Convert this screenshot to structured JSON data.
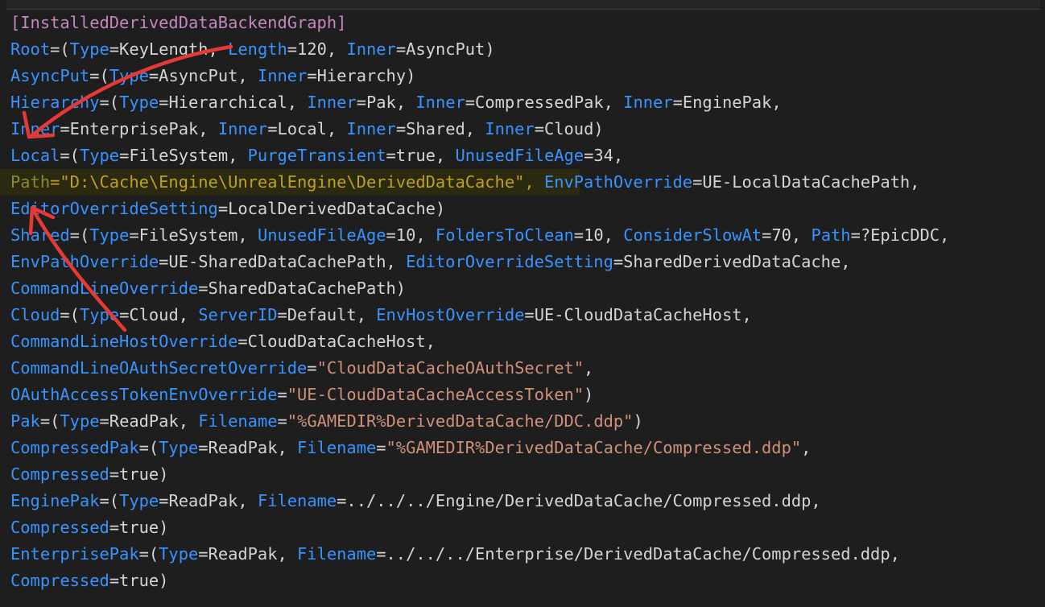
{
  "title": "[InstalledDerivedDataBackendGraph]",
  "lines": [
    [
      {
        "t": "[InstalledDerivedDataBackendGraph]",
        "c": "sec"
      }
    ],
    [
      {
        "t": "Root",
        "c": "k"
      },
      {
        "t": "=(",
        "c": "v"
      },
      {
        "t": "Type",
        "c": "k"
      },
      {
        "t": "=KeyLength, ",
        "c": "v"
      },
      {
        "t": "Length",
        "c": "k"
      },
      {
        "t": "=120, ",
        "c": "v"
      },
      {
        "t": "Inner",
        "c": "k"
      },
      {
        "t": "=AsyncPut)",
        "c": "v"
      }
    ],
    [
      {
        "t": "AsyncPut",
        "c": "k"
      },
      {
        "t": "=(",
        "c": "v"
      },
      {
        "t": "Type",
        "c": "k"
      },
      {
        "t": "=AsyncPut, ",
        "c": "v"
      },
      {
        "t": "Inner",
        "c": "k"
      },
      {
        "t": "=Hierarchy)",
        "c": "v"
      }
    ],
    [
      {
        "t": "Hierarchy",
        "c": "k"
      },
      {
        "t": "=(",
        "c": "v"
      },
      {
        "t": "Type",
        "c": "k"
      },
      {
        "t": "=Hierarchical, ",
        "c": "v"
      },
      {
        "t": "Inner",
        "c": "k"
      },
      {
        "t": "=Pak, ",
        "c": "v"
      },
      {
        "t": "Inner",
        "c": "k"
      },
      {
        "t": "=CompressedPak, ",
        "c": "v"
      },
      {
        "t": "Inner",
        "c": "k"
      },
      {
        "t": "=EnginePak,",
        "c": "v"
      }
    ],
    [
      {
        "t": "Inner",
        "c": "k"
      },
      {
        "t": "=EnterprisePak, ",
        "c": "v"
      },
      {
        "t": "Inner",
        "c": "k"
      },
      {
        "t": "=Local, ",
        "c": "v"
      },
      {
        "t": "Inner",
        "c": "k"
      },
      {
        "t": "=Shared, ",
        "c": "v"
      },
      {
        "t": "Inner",
        "c": "k"
      },
      {
        "t": "=Cloud)",
        "c": "v"
      }
    ],
    [
      {
        "t": "Local",
        "c": "k"
      },
      {
        "t": "=(",
        "c": "v"
      },
      {
        "t": "Type",
        "c": "k"
      },
      {
        "t": "=FileSystem, ",
        "c": "v"
      },
      {
        "t": "PurgeTransient",
        "c": "k"
      },
      {
        "t": "=true, ",
        "c": "v"
      },
      {
        "t": "UnusedFileAge",
        "c": "k"
      },
      {
        "t": "=34,",
        "c": "v"
      }
    ],
    [
      {
        "t": "Path",
        "c": "hk"
      },
      {
        "t": "=",
        "c": "hs"
      },
      {
        "t": "\"D:\\Cache\\Engine\\UnrealEngine\\DerivedDataCache\",",
        "c": "hs"
      },
      {
        "t": " ",
        "c": "v"
      },
      {
        "t": "EnvPathOverride",
        "c": "k"
      },
      {
        "t": "=UE-LocalDataCachePath,",
        "c": "v"
      }
    ],
    [
      {
        "t": "EditorOverrideSetting",
        "c": "k"
      },
      {
        "t": "=LocalDerivedDataCache)",
        "c": "v"
      }
    ],
    [
      {
        "t": "Shared",
        "c": "k"
      },
      {
        "t": "=(",
        "c": "v"
      },
      {
        "t": "Type",
        "c": "k"
      },
      {
        "t": "=FileSystem, ",
        "c": "v"
      },
      {
        "t": "UnusedFileAge",
        "c": "k"
      },
      {
        "t": "=10, ",
        "c": "v"
      },
      {
        "t": "FoldersToClean",
        "c": "k"
      },
      {
        "t": "=10, ",
        "c": "v"
      },
      {
        "t": "ConsiderSlowAt",
        "c": "k"
      },
      {
        "t": "=70, ",
        "c": "v"
      },
      {
        "t": "Path",
        "c": "k"
      },
      {
        "t": "=?EpicDDC,",
        "c": "v"
      }
    ],
    [
      {
        "t": "EnvPathOverride",
        "c": "k"
      },
      {
        "t": "=UE-SharedDataCachePath, ",
        "c": "v"
      },
      {
        "t": "EditorOverrideSetting",
        "c": "k"
      },
      {
        "t": "=SharedDerivedDataCache,",
        "c": "v"
      }
    ],
    [
      {
        "t": "CommandLineOverride",
        "c": "k"
      },
      {
        "t": "=SharedDataCachePath)",
        "c": "v"
      }
    ],
    [
      {
        "t": "Cloud",
        "c": "k"
      },
      {
        "t": "=(",
        "c": "v"
      },
      {
        "t": "Type",
        "c": "k"
      },
      {
        "t": "=Cloud, ",
        "c": "v"
      },
      {
        "t": "ServerID",
        "c": "k"
      },
      {
        "t": "=Default, ",
        "c": "v"
      },
      {
        "t": "EnvHostOverride",
        "c": "k"
      },
      {
        "t": "=UE-CloudDataCacheHost,",
        "c": "v"
      }
    ],
    [
      {
        "t": "CommandLineHostOverride",
        "c": "k"
      },
      {
        "t": "=CloudDataCacheHost,",
        "c": "v"
      }
    ],
    [
      {
        "t": "CommandLineOAuthSecretOverride",
        "c": "k"
      },
      {
        "t": "=",
        "c": "v"
      },
      {
        "t": "\"CloudDataCacheOAuthSecret\"",
        "c": "s"
      },
      {
        "t": ",",
        "c": "v"
      }
    ],
    [
      {
        "t": "OAuthAccessTokenEnvOverride",
        "c": "k"
      },
      {
        "t": "=",
        "c": "v"
      },
      {
        "t": "\"UE-CloudDataCacheAccessToken\"",
        "c": "s"
      },
      {
        "t": ")",
        "c": "v"
      }
    ],
    [
      {
        "t": "Pak",
        "c": "k"
      },
      {
        "t": "=(",
        "c": "v"
      },
      {
        "t": "Type",
        "c": "k"
      },
      {
        "t": "=ReadPak, ",
        "c": "v"
      },
      {
        "t": "Filename",
        "c": "k"
      },
      {
        "t": "=",
        "c": "v"
      },
      {
        "t": "\"%GAMEDIR%DerivedDataCache/DDC.ddp\"",
        "c": "s"
      },
      {
        "t": ")",
        "c": "v"
      }
    ],
    [
      {
        "t": "CompressedPak",
        "c": "k"
      },
      {
        "t": "=(",
        "c": "v"
      },
      {
        "t": "Type",
        "c": "k"
      },
      {
        "t": "=ReadPak, ",
        "c": "v"
      },
      {
        "t": "Filename",
        "c": "k"
      },
      {
        "t": "=",
        "c": "v"
      },
      {
        "t": "\"%GAMEDIR%DerivedDataCache/Compressed.ddp\"",
        "c": "s"
      },
      {
        "t": ",",
        "c": "v"
      }
    ],
    [
      {
        "t": "Compressed",
        "c": "k"
      },
      {
        "t": "=true)",
        "c": "v"
      }
    ],
    [
      {
        "t": "EnginePak",
        "c": "k"
      },
      {
        "t": "=(",
        "c": "v"
      },
      {
        "t": "Type",
        "c": "k"
      },
      {
        "t": "=ReadPak, ",
        "c": "v"
      },
      {
        "t": "Filename",
        "c": "k"
      },
      {
        "t": "=../../../Engine/DerivedDataCache/Compressed.ddp,",
        "c": "v"
      }
    ],
    [
      {
        "t": "Compressed",
        "c": "k"
      },
      {
        "t": "=true)",
        "c": "v"
      }
    ],
    [
      {
        "t": "EnterprisePak",
        "c": "k"
      },
      {
        "t": "=(",
        "c": "v"
      },
      {
        "t": "Type",
        "c": "k"
      },
      {
        "t": "=ReadPak, ",
        "c": "v"
      },
      {
        "t": "Filename",
        "c": "k"
      },
      {
        "t": "=../../../Enterprise/DerivedDataCache/Compressed.ddp,",
        "c": "v"
      }
    ],
    [
      {
        "t": "Compressed",
        "c": "k"
      },
      {
        "t": "=true)",
        "c": "v"
      }
    ]
  ],
  "highlighted_line": 6,
  "colors": {
    "background": "#1e1e1e",
    "key": "#3794ff",
    "value": "#d4d4d4",
    "string": "#ce9178",
    "section": "#c586c0",
    "highlight": "#2b2a11",
    "annotation_arrow": "#e53935"
  },
  "annotations": [
    "red-arrow-upper",
    "red-arrow-lower"
  ]
}
